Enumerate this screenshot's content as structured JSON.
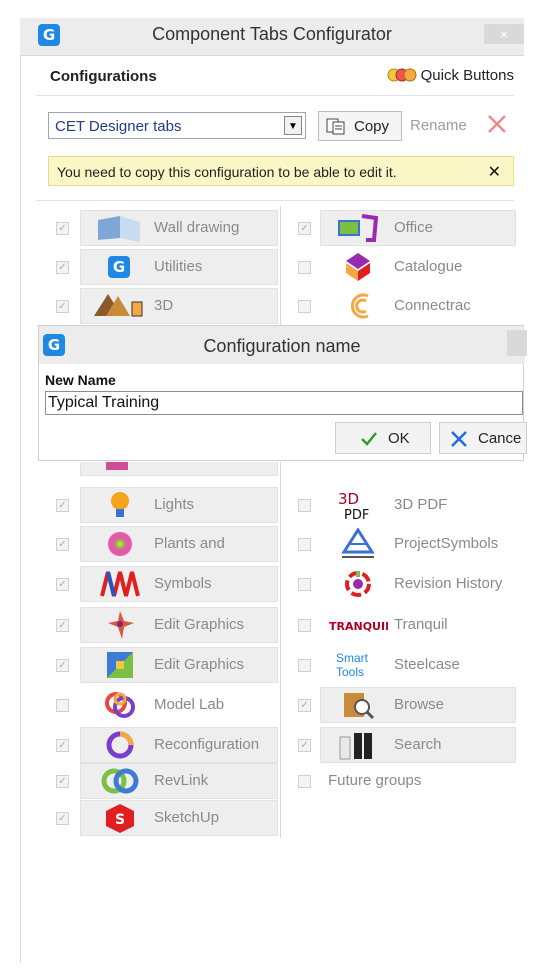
{
  "window": {
    "title": "Component Tabs Configurator",
    "close_glyph": "×"
  },
  "configurations": {
    "label": "Configurations",
    "quick_buttons_label": "Quick Buttons",
    "selected": "CET Designer tabs",
    "copy_label": "Copy",
    "rename_label": "Rename"
  },
  "warning": {
    "text": "You need to copy this configuration to be able to edit it.",
    "close_glyph": "✕"
  },
  "left_items": [
    {
      "label": "Wall drawing",
      "checked": true,
      "highlight": true,
      "icon": "wall-drawing-icon"
    },
    {
      "label": "Utilities",
      "checked": true,
      "highlight": true,
      "icon": "utilities-icon"
    },
    {
      "label": "3D",
      "checked": true,
      "highlight": true,
      "icon": "3d-icon"
    },
    {
      "label": "",
      "checked": false,
      "highlight": true,
      "icon": "hidden-icon"
    },
    {
      "label": "Lights",
      "checked": true,
      "highlight": true,
      "icon": "lights-icon"
    },
    {
      "label": "Plants and",
      "checked": true,
      "highlight": true,
      "icon": "plants-icon"
    },
    {
      "label": "Symbols",
      "checked": true,
      "highlight": true,
      "icon": "symbols-icon"
    },
    {
      "label": "Edit Graphics",
      "checked": true,
      "highlight": true,
      "icon": "edit-graphics-icon"
    },
    {
      "label": "Edit Graphics",
      "checked": true,
      "highlight": true,
      "icon": "edit-graphics-2-icon"
    },
    {
      "label": "Model Lab",
      "checked": false,
      "highlight": false,
      "icon": "model-lab-icon"
    },
    {
      "label": "Reconfiguration",
      "checked": true,
      "highlight": true,
      "icon": "reconfiguration-icon"
    },
    {
      "label": "RevLink",
      "checked": true,
      "highlight": true,
      "icon": "revlink-icon"
    },
    {
      "label": "SketchUp",
      "checked": true,
      "highlight": true,
      "icon": "sketchup-icon"
    }
  ],
  "right_items": [
    {
      "label": "Office",
      "checked": true,
      "highlight": true,
      "icon": "office-icon"
    },
    {
      "label": "Catalogue",
      "checked": false,
      "highlight": false,
      "icon": "catalogue-icon"
    },
    {
      "label": "Connectrac",
      "checked": false,
      "highlight": false,
      "icon": "connectrac-icon"
    },
    {
      "label": "",
      "checked": false,
      "highlight": false,
      "icon": "hidden-icon"
    },
    {
      "label": "3D PDF",
      "checked": false,
      "highlight": false,
      "icon": "3d-pdf-icon"
    },
    {
      "label": "ProjectSymbols",
      "checked": false,
      "highlight": false,
      "icon": "project-symbols-icon"
    },
    {
      "label": "Revision History",
      "checked": false,
      "highlight": false,
      "icon": "revision-history-icon"
    },
    {
      "label": "Tranquil",
      "checked": false,
      "highlight": false,
      "icon": "tranquil-icon"
    },
    {
      "label": "Steelcase",
      "checked": false,
      "highlight": false,
      "icon": "steelcase-icon"
    },
    {
      "label": "Browse",
      "checked": true,
      "highlight": true,
      "icon": "browse-icon"
    },
    {
      "label": "Search",
      "checked": true,
      "highlight": true,
      "icon": "search-icon"
    },
    {
      "label": "Future groups",
      "checked": false,
      "highlight": false,
      "icon": ""
    }
  ],
  "icon_text": {
    "three_d_pdf": "3D",
    "pdf": "PDF",
    "tranquil": "TRANQUIL",
    "smart": "Smart",
    "tools": "Tools"
  },
  "dialog": {
    "title": "Configuration name",
    "field_label": "New Name",
    "field_value": "Typical Training",
    "ok_label": "OK",
    "cancel_label": "Cance"
  },
  "colors": {
    "accent": "#1e88e5",
    "warning_bg": "#fbf6c5",
    "delete_red": "#e53935",
    "ok_green": "#2e9e2e",
    "cancel_blue": "#1e6fd9"
  }
}
